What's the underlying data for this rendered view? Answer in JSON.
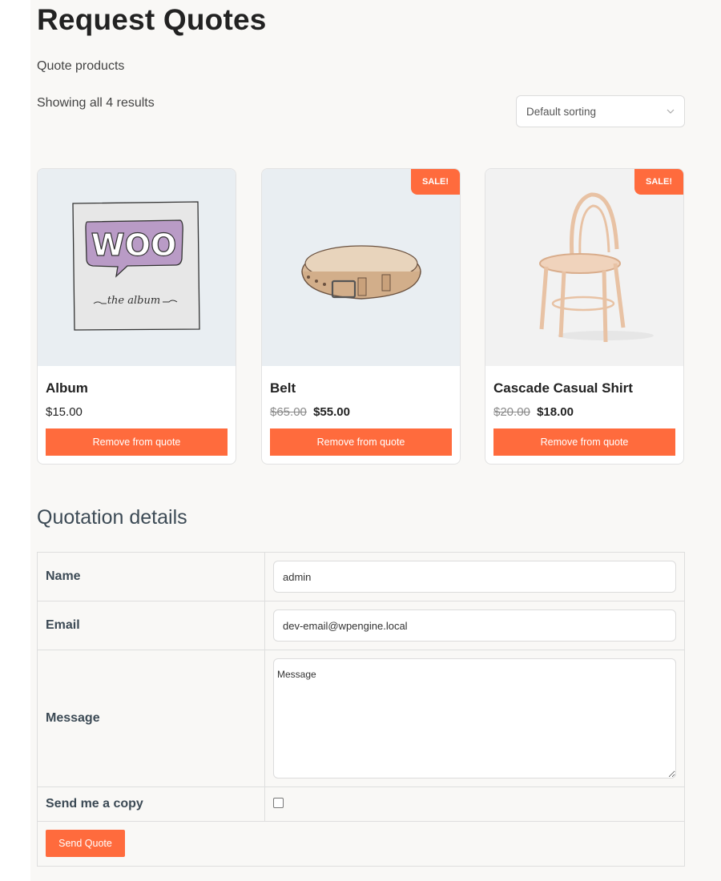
{
  "page": {
    "title": "Request Quotes",
    "subtitle": "Quote products",
    "result_count": "Showing all 4 results"
  },
  "sorting": {
    "selected": "Default sorting"
  },
  "products": [
    {
      "name": "Album",
      "price": "$15.00",
      "regular_price": "",
      "sale_price": "",
      "on_sale": false,
      "image": "woo-album-image",
      "image_text": "WOO",
      "image_caption": "the album",
      "action_label": "Remove from quote"
    },
    {
      "name": "Belt",
      "price": "",
      "regular_price": "$65.00",
      "sale_price": "$55.00",
      "on_sale": true,
      "badge": "SALE!",
      "image": "belt-image",
      "action_label": "Remove from quote"
    },
    {
      "name": "Cascade Casual Shirt",
      "price": "",
      "regular_price": "$20.00",
      "sale_price": "$18.00",
      "on_sale": true,
      "badge": "SALE!",
      "image": "chair-image",
      "action_label": "Remove from quote"
    }
  ],
  "quotation": {
    "title": "Quotation details",
    "name_label": "Name",
    "name_value": "admin",
    "email_label": "Email",
    "email_value": "dev-email@wpengine.local",
    "message_label": "Message",
    "message_placeholder": "Message",
    "copy_label": "Send me a copy",
    "copy_checked": false,
    "submit_label": "Send Quote"
  },
  "colors": {
    "accent": "#ff6b3d",
    "background": "#f9f8f6",
    "heading": "#222222",
    "section_heading": "#3c4a55"
  }
}
